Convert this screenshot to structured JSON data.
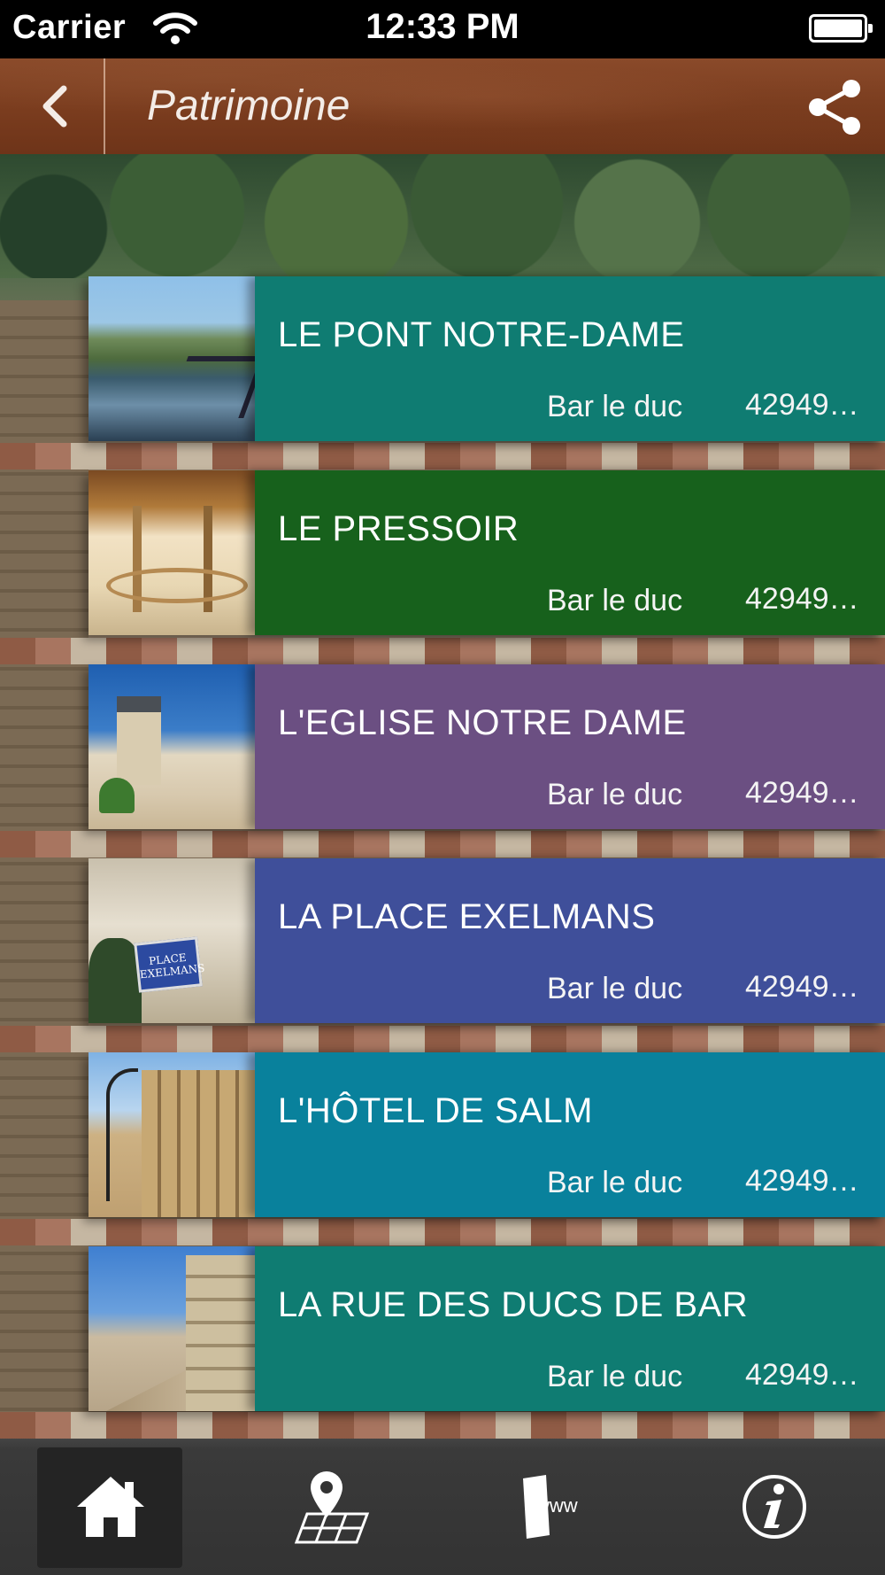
{
  "status_bar": {
    "carrier": "Carrier",
    "time": "12:33 PM",
    "wifi_icon": "wifi-icon",
    "battery_icon": "battery-icon"
  },
  "header": {
    "title": "Patrimoine",
    "back_icon": "chevron-left-icon",
    "share_icon": "share-icon",
    "background_color": "#7a3c1e"
  },
  "list": {
    "items": [
      {
        "title": "LE PONT NOTRE-DAME",
        "city": "Bar le duc",
        "phone": "42949…",
        "color": "#0f7c72"
      },
      {
        "title": "LE PRESSOIR",
        "city": "Bar le duc",
        "phone": "42949…",
        "color": "#17611c"
      },
      {
        "title": "L'EGLISE NOTRE DAME",
        "city": "Bar le duc",
        "phone": "42949…",
        "color": "#6b4f82"
      },
      {
        "title": "LA PLACE EXELMANS",
        "city": "Bar le duc",
        "phone": "42949…",
        "color": "#3f4f9a"
      },
      {
        "title": "L'HÔTEL DE SALM",
        "city": "Bar le duc",
        "phone": "42949…",
        "color": "#09819c"
      },
      {
        "title": "LA RUE DES DUCS DE BAR",
        "city": "Bar le duc",
        "phone": "42949…",
        "color": "#0f7c72"
      }
    ],
    "thumbnail_texts": {
      "place_sign": "PLACE EXELMANS"
    }
  },
  "tab_bar": {
    "tabs": [
      {
        "icon": "home-icon",
        "active": true
      },
      {
        "icon": "map-pin-icon",
        "active": false
      },
      {
        "icon": "www-icon",
        "label": "www",
        "active": false
      },
      {
        "icon": "info-icon",
        "active": false
      }
    ]
  }
}
